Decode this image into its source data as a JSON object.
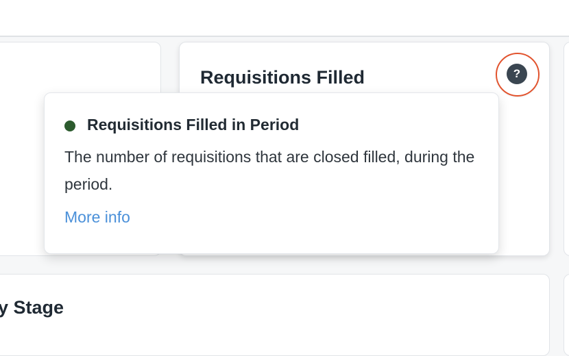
{
  "cards": {
    "requisitions_filled": {
      "title": "Requisitions Filled"
    },
    "lower": {
      "title_partial": "ey Stage"
    }
  },
  "help_button": {
    "icon": "question-mark-icon",
    "glyph": "?"
  },
  "tooltip": {
    "series_color": "#2c5b2e",
    "title": "Requisitions Filled in Period",
    "description": "The number of requisitions that are closed filled, during the period.",
    "link_label": "More info",
    "link_color": "#4a90d9"
  },
  "colors": {
    "highlight_ring": "#e2522c",
    "help_icon_bg": "#3a4651"
  }
}
